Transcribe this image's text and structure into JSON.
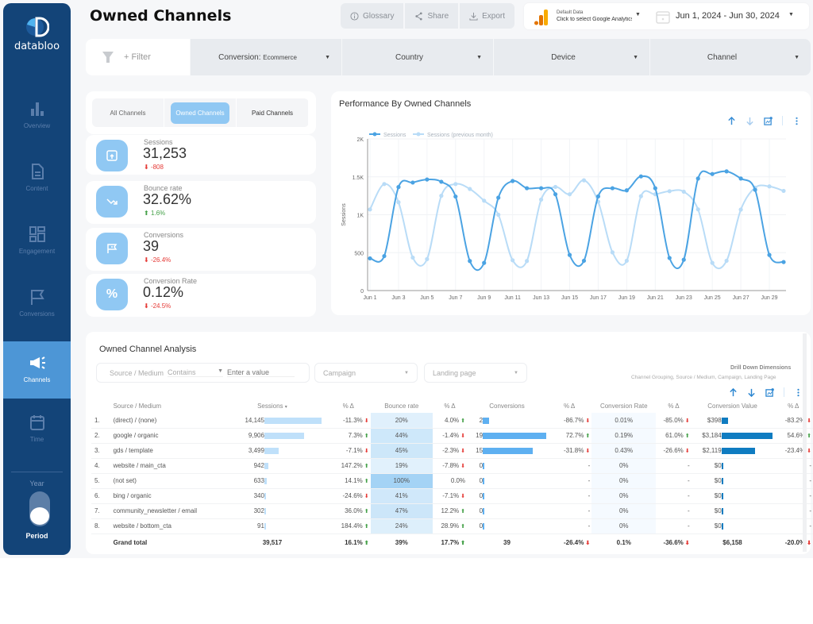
{
  "brand": {
    "name": "databloo"
  },
  "page_title": "Owned Channels",
  "header": {
    "buttons": [
      {
        "label": "Glossary",
        "icon": "info-icon"
      },
      {
        "label": "Share",
        "icon": "share-icon"
      },
      {
        "label": "Export",
        "icon": "download-icon"
      }
    ],
    "datasource": {
      "label": "Default Data",
      "value": "Click to select Google Analytics"
    },
    "date_range": "Jun 1, 2024 - Jun 30, 2024"
  },
  "sidebar": {
    "items": [
      {
        "label": "Overview",
        "icon": "bar-chart-icon",
        "active": false
      },
      {
        "label": "Content",
        "icon": "document-icon",
        "active": false
      },
      {
        "label": "Engagement",
        "icon": "grid-icon",
        "active": false
      },
      {
        "label": "Conversions",
        "icon": "flag-icon",
        "active": false
      },
      {
        "label": "Channels",
        "icon": "megaphone-icon",
        "active": true
      },
      {
        "label": "Time",
        "icon": "calendar-icon",
        "active": false
      }
    ],
    "toggle_top": "Year",
    "toggle_bottom": "Period"
  },
  "filters": {
    "add_filter": "+ Filter",
    "conversion_label": "Conversion:",
    "conversion_value": "Ecommerce",
    "country": "Country",
    "device": "Device",
    "channel": "Channel"
  },
  "channel_tabs": [
    {
      "label": "All Channels",
      "selected": false
    },
    {
      "label": "Owned Channels",
      "selected": true
    },
    {
      "label": "Paid Channels",
      "selected": false
    }
  ],
  "kpis": [
    {
      "label": "Sessions",
      "value": "31,253",
      "delta": "-808",
      "direction": "down",
      "icon": "window-upload-icon"
    },
    {
      "label": "Bounce rate",
      "value": "32.62%",
      "delta": "1.6%",
      "direction": "up",
      "icon": "trend-arrow-icon"
    },
    {
      "label": "Conversions",
      "value": "39",
      "delta": "-26.4%",
      "direction": "down",
      "icon": "flag-icon"
    },
    {
      "label": "Conversion Rate",
      "value": "0.12%",
      "delta": "-24.5%",
      "direction": "down",
      "icon": "percent-icon"
    }
  ],
  "chart_data": {
    "type": "line",
    "title": "Performance By Owned Channels",
    "xlabel": "",
    "ylabel": "Sessions",
    "ylim": [
      0,
      2000
    ],
    "yticks": [
      "0",
      "500",
      "1K",
      "1.5K",
      "2K"
    ],
    "ytick_values": [
      0,
      500,
      1000,
      1500,
      2000
    ],
    "x": [
      "Jun 1",
      "Jun 2",
      "Jun 3",
      "Jun 4",
      "Jun 5",
      "Jun 6",
      "Jun 7",
      "Jun 8",
      "Jun 9",
      "Jun 10",
      "Jun 11",
      "Jun 12",
      "Jun 13",
      "Jun 14",
      "Jun 15",
      "Jun 16",
      "Jun 17",
      "Jun 18",
      "Jun 19",
      "Jun 20",
      "Jun 21",
      "Jun 22",
      "Jun 23",
      "Jun 24",
      "Jun 25",
      "Jun 26",
      "Jun 27",
      "Jun 28",
      "Jun 29",
      "Jun 30"
    ],
    "xtick_labels": [
      "Jun 1",
      "Jun 3",
      "Jun 5",
      "Jun 7",
      "Jun 9",
      "Jun 11",
      "Jun 13",
      "Jun 15",
      "Jun 17",
      "Jun 19",
      "Jun 21",
      "Jun 23",
      "Jun 25",
      "Jun 27",
      "Jun 29"
    ],
    "grid": true,
    "legend": "top-left",
    "series": [
      {
        "name": "Sessions",
        "color": "#4ba3e3",
        "values": [
          425,
          455,
          1365,
          1425,
          1465,
          1435,
          1240,
          390,
          365,
          1225,
          1445,
          1350,
          1350,
          1270,
          470,
          393,
          1242,
          1350,
          1322,
          1506,
          1350,
          430,
          407,
          1478,
          1537,
          1572,
          1478,
          1329,
          470,
          376
        ]
      },
      {
        "name": "Sessions (previous month)",
        "color": "#b9dcf7",
        "values": [
          1070,
          1405,
          1165,
          435,
          415,
          1250,
          1405,
          1340,
          1185,
          1000,
          400,
          390,
          1200,
          1367,
          1270,
          1454,
          1172,
          504,
          393,
          1245,
          1270,
          1311,
          1304,
          1071,
          365,
          393,
          1068,
          1357,
          1374,
          1315
        ]
      }
    ]
  },
  "analysis": {
    "title": "Owned Channel Analysis",
    "filter": {
      "field": "Source / Medium",
      "operator": "Contains",
      "placeholder": "Enter a value"
    },
    "campaign": "Campaign",
    "landing_page": "Landing page",
    "drill_title": "Drill Down Dimensions",
    "drill_dims": "Channel Grouping, Source / Medium, Campaign, Landing Page",
    "columns": [
      "Source / Medium",
      "Sessions",
      "% Δ",
      "Bounce rate",
      "% Δ",
      "Conversions",
      "% Δ",
      "Conversion Rate",
      "% Δ",
      "Conversion Value",
      "% Δ"
    ],
    "sort_indicator": "▾",
    "max": {
      "sessions": 14145,
      "conversions": 19,
      "value": 3184,
      "bounce": 100
    },
    "rows": [
      {
        "idx": "1.",
        "source": "(direct) / (none)",
        "sessions": "14,145",
        "s_num": 14145,
        "s_d": "-11.3%",
        "s_dir": "down",
        "bounce": "20%",
        "b_num": 20,
        "b_d": "4.0%",
        "b_dir": "up",
        "conv": "2",
        "c_num": 2,
        "c_d": "-86.7%",
        "c_dir": "down",
        "cr": "0.01%",
        "cr_d": "-85.0%",
        "cr_dir": "down",
        "val": "$398",
        "v_num": 398,
        "v_d": "-83.2%",
        "v_dir": "down"
      },
      {
        "idx": "2.",
        "source": "google / organic",
        "sessions": "9,906",
        "s_num": 9906,
        "s_d": "7.3%",
        "s_dir": "up",
        "bounce": "44%",
        "b_num": 44,
        "b_d": "-1.4%",
        "b_dir": "down",
        "conv": "19",
        "c_num": 19,
        "c_d": "72.7%",
        "c_dir": "up",
        "cr": "0.19%",
        "cr_d": "61.0%",
        "cr_dir": "up",
        "val": "$3,184",
        "v_num": 3184,
        "v_d": "54.6%",
        "v_dir": "up"
      },
      {
        "idx": "3.",
        "source": "gds / template",
        "sessions": "3,499",
        "s_num": 3499,
        "s_d": "-7.1%",
        "s_dir": "down",
        "bounce": "45%",
        "b_num": 45,
        "b_d": "-2.3%",
        "b_dir": "down",
        "conv": "15",
        "c_num": 15,
        "c_d": "-31.8%",
        "c_dir": "down",
        "cr": "0.43%",
        "cr_d": "-26.6%",
        "cr_dir": "down",
        "val": "$2,119",
        "v_num": 2119,
        "v_d": "-23.4%",
        "v_dir": "down"
      },
      {
        "idx": "4.",
        "source": "website / main_cta",
        "sessions": "942",
        "s_num": 942,
        "s_d": "147.2%",
        "s_dir": "up",
        "bounce": "19%",
        "b_num": 19,
        "b_d": "-7.8%",
        "b_dir": "down",
        "conv": "0",
        "c_num": 0,
        "c_d": "-",
        "c_dir": "",
        "cr": "0%",
        "cr_d": "-",
        "cr_dir": "",
        "val": "$0",
        "v_num": 0,
        "v_d": "-",
        "v_dir": ""
      },
      {
        "idx": "5.",
        "source": "(not set)",
        "sessions": "633",
        "s_num": 633,
        "s_d": "14.1%",
        "s_dir": "up",
        "bounce": "100%",
        "b_num": 100,
        "b_d": "0.0%",
        "b_dir": "",
        "conv": "0",
        "c_num": 0,
        "c_d": "-",
        "c_dir": "",
        "cr": "0%",
        "cr_d": "-",
        "cr_dir": "",
        "val": "$0",
        "v_num": 0,
        "v_d": "-",
        "v_dir": ""
      },
      {
        "idx": "6.",
        "source": "bing / organic",
        "sessions": "340",
        "s_num": 340,
        "s_d": "-24.6%",
        "s_dir": "down",
        "bounce": "41%",
        "b_num": 41,
        "b_d": "-7.1%",
        "b_dir": "down",
        "conv": "0",
        "c_num": 0,
        "c_d": "-",
        "c_dir": "",
        "cr": "0%",
        "cr_d": "-",
        "cr_dir": "",
        "val": "$0",
        "v_num": 0,
        "v_d": "-",
        "v_dir": ""
      },
      {
        "idx": "7.",
        "source": "community_newsletter / email",
        "sessions": "302",
        "s_num": 302,
        "s_d": "36.0%",
        "s_dir": "up",
        "bounce": "47%",
        "b_num": 47,
        "b_d": "12.2%",
        "b_dir": "up",
        "conv": "0",
        "c_num": 0,
        "c_d": "-",
        "c_dir": "",
        "cr": "0%",
        "cr_d": "-",
        "cr_dir": "",
        "val": "$0",
        "v_num": 0,
        "v_d": "-",
        "v_dir": ""
      },
      {
        "idx": "8.",
        "source": "website / bottom_cta",
        "sessions": "91",
        "s_num": 91,
        "s_d": "184.4%",
        "s_dir": "up",
        "bounce": "24%",
        "b_num": 24,
        "b_d": "28.9%",
        "b_dir": "up",
        "conv": "0",
        "c_num": 0,
        "c_d": "-",
        "c_dir": "",
        "cr": "0%",
        "cr_d": "-",
        "cr_dir": "",
        "val": "$0",
        "v_num": 0,
        "v_d": "-",
        "v_dir": ""
      }
    ],
    "total": {
      "label": "Grand total",
      "sessions": "39,517",
      "s_d": "16.1%",
      "s_dir": "up",
      "bounce": "39%",
      "b_d": "17.7%",
      "b_dir": "up",
      "conv": "39",
      "c_d": "-26.4%",
      "c_dir": "down",
      "cr": "0.1%",
      "cr_d": "-36.6%",
      "cr_dir": "down",
      "val": "$6,158",
      "v_d": "-20.0%",
      "v_dir": "down"
    }
  },
  "colors": {
    "sidebar": "#134478",
    "accent": "#4d96d6",
    "kpi_icon": "#90c8f3",
    "negative": "#e53935",
    "positive": "#43a047"
  }
}
